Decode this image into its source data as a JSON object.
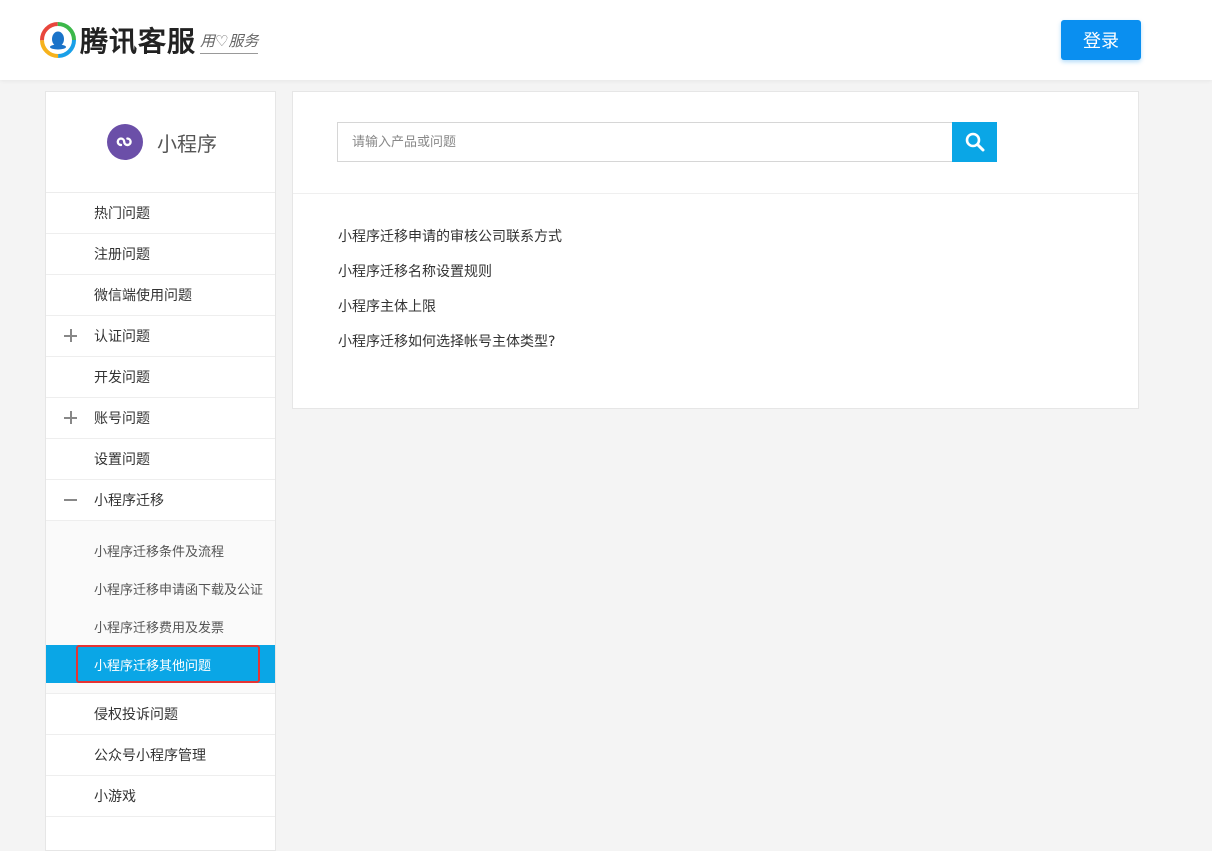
{
  "header": {
    "brand": "腾讯客服",
    "slogan": "用♡服务",
    "login_label": "登录"
  },
  "sidebar": {
    "title": "小程序",
    "items": [
      {
        "label": "热门问题",
        "toggle": "none"
      },
      {
        "label": "注册问题",
        "toggle": "none"
      },
      {
        "label": "微信端使用问题",
        "toggle": "none"
      },
      {
        "label": "认证问题",
        "toggle": "plus"
      },
      {
        "label": "开发问题",
        "toggle": "none"
      },
      {
        "label": "账号问题",
        "toggle": "plus"
      },
      {
        "label": "设置问题",
        "toggle": "none"
      },
      {
        "label": "小程序迁移",
        "toggle": "minus"
      }
    ],
    "sub_items": [
      {
        "label": "小程序迁移条件及流程"
      },
      {
        "label": "小程序迁移申请函下载及公证"
      },
      {
        "label": "小程序迁移费用及发票"
      },
      {
        "label": "小程序迁移其他问题",
        "active": true
      }
    ],
    "items_after": [
      {
        "label": "侵权投诉问题"
      },
      {
        "label": "公众号小程序管理"
      },
      {
        "label": "小游戏"
      }
    ]
  },
  "search": {
    "placeholder": "请输入产品或问题",
    "value": ""
  },
  "articles": [
    "小程序迁移申请的审核公司联系方式",
    "小程序迁移名称设置规则",
    "小程序主体上限",
    "小程序迁移如何选择帐号主体类型?"
  ],
  "colors": {
    "accent": "#0aa6e6",
    "login": "#0a8ff0",
    "highlight_box": "#e63333",
    "mini_program_icon": "#6b4fa8"
  }
}
